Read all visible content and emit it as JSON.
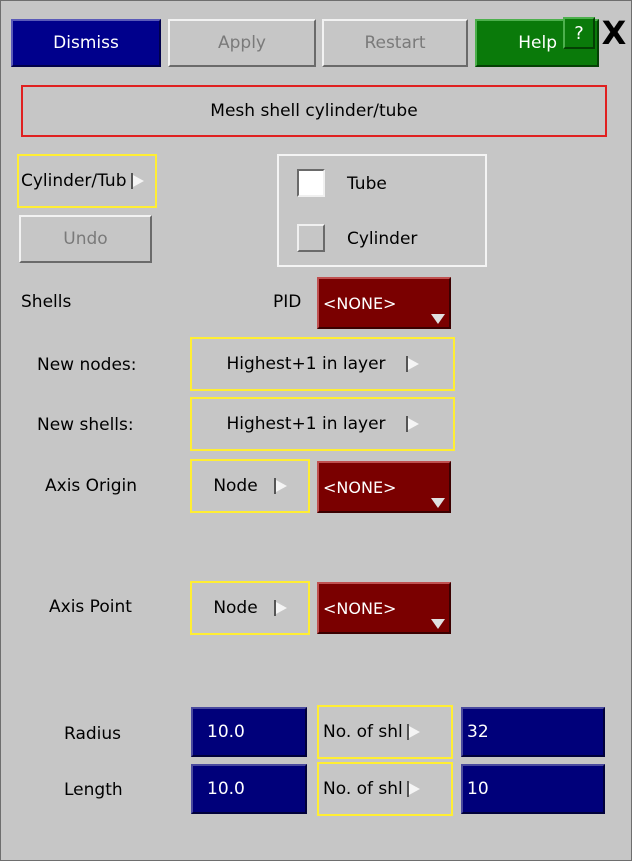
{
  "toolbar": {
    "dismiss": "Dismiss",
    "apply": "Apply",
    "restart": "Restart",
    "help": "Help",
    "question": "?",
    "close": "X"
  },
  "title": "Mesh shell cylinder/tube",
  "mode_menu": "Cylinder/Tub",
  "undo": "Undo",
  "type_group": {
    "tube": "Tube",
    "cylinder": "Cylinder"
  },
  "shells": {
    "label": "Shells",
    "pid_label": "PID",
    "pid_value": "<NONE>"
  },
  "new_nodes": {
    "label": "New nodes:",
    "value": "Highest+1 in layer"
  },
  "new_shells": {
    "label": "New shells:",
    "value": "Highest+1 in layer"
  },
  "axis_origin": {
    "label": "Axis Origin",
    "type": "Node",
    "value": "<NONE>"
  },
  "axis_point": {
    "label": "Axis Point",
    "type": "Node",
    "value": "<NONE>"
  },
  "radius": {
    "label": "Radius",
    "value": "10.0",
    "menu": "No. of shl",
    "count": "32"
  },
  "length": {
    "label": "Length",
    "value": "10.0",
    "menu": "No. of shl",
    "count": "10"
  }
}
